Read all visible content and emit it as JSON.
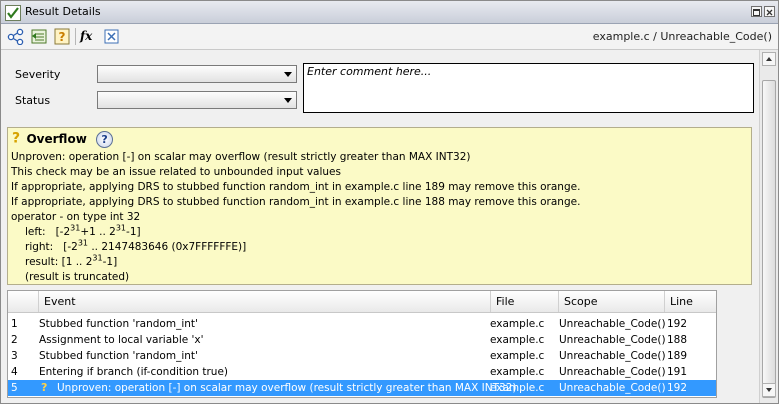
{
  "window": {
    "title": "Result Details",
    "colors": {
      "titlebar": "#c9ced9",
      "info_bg": "#fbfac6",
      "selection": "#3399ff",
      "warn": "#d7a300"
    }
  },
  "toolbar": {
    "icons": [
      "graph-icon",
      "results-list-icon",
      "question-icon",
      "fx-icon",
      "variable-icon"
    ],
    "fx_label": "fx",
    "path": "example.c / Unreachable_Code()"
  },
  "form": {
    "severity_label": "Severity",
    "status_label": "Status",
    "severity_value": "",
    "status_value": "",
    "comment_placeholder": "Enter comment here..."
  },
  "info": {
    "check_symbol": "?",
    "title": "Overflow",
    "help_glyph": "?",
    "line1": "Unproven: operation [-] on scalar may overflow (result strictly greater than MAX INT32)",
    "line2": "This check may be an issue related to unbounded input values",
    "line3": "If appropriate, applying DRS to stubbed function random_int in example.c line 189 may remove this orange.",
    "line4": "If appropriate, applying DRS to stubbed function random_int in example.c line 188 may remove this orange.",
    "line5": "operator - on type int 32",
    "left_label": "left:",
    "left_value": {
      "a": "[-2",
      "b": "31",
      "c": "+1 .. 2",
      "d": "31",
      "e": "-1]"
    },
    "right_label": "right:",
    "right_value": {
      "a": "[-2",
      "b": "31",
      "c": " .. 2147483646 (0x7FFFFFFE)]"
    },
    "result_label": "result:",
    "result_value": {
      "a": "[1 .. 2",
      "b": "31",
      "c": "-1]"
    },
    "truncated": "(result is truncated)"
  },
  "table": {
    "headers": {
      "num": "",
      "event": "Event",
      "file": "File",
      "scope": "Scope",
      "line": "Line"
    },
    "rows": [
      {
        "num": "1",
        "event": "Stubbed function 'random_int'",
        "file": "example.c",
        "scope": "Unreachable_Code()",
        "line": "192"
      },
      {
        "num": "2",
        "event": "Assignment to local variable 'x'",
        "file": "example.c",
        "scope": "Unreachable_Code()",
        "line": "188"
      },
      {
        "num": "3",
        "event": "Stubbed function 'random_int'",
        "file": "example.c",
        "scope": "Unreachable_Code()",
        "line": "189"
      },
      {
        "num": "4",
        "event": "Entering if branch (if-condition true)",
        "file": "example.c",
        "scope": "Unreachable_Code()",
        "line": "191"
      },
      {
        "num": "5",
        "mark": "?",
        "event": "Unproven: operation [-] on scalar may overflow (result strictly greater than MAX INT32)",
        "file": "example.c",
        "scope": "Unreachable_Code()",
        "line": "192"
      }
    ]
  }
}
